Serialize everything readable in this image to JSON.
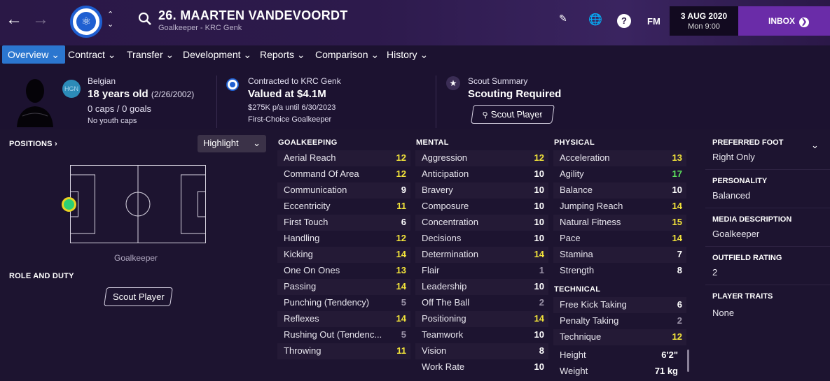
{
  "header": {
    "player_name": "26. MAARTEN VANDEVOORDT",
    "subtitle": "Goalkeeper - KRC Genk",
    "fm_label": "FM",
    "date": "3 AUG 2020",
    "time": "Mon 9:00",
    "inbox_label": "INBOX",
    "help_label": "?"
  },
  "tabs": [
    {
      "label": "Overview ⌄"
    },
    {
      "label": "Contract ⌄"
    },
    {
      "label": "Transfer ⌄"
    },
    {
      "label": "Development ⌄"
    },
    {
      "label": "Reports ⌄"
    },
    {
      "label": "Comparison ⌄"
    },
    {
      "label": "History ⌄"
    }
  ],
  "bio": {
    "nation_code": "HGN",
    "nationality": "Belgian",
    "age": "18 years old",
    "dob": "(2/26/2002)",
    "caps": "0 caps / 0 goals",
    "youth_caps": "No youth caps"
  },
  "contract": {
    "contracted_to": "Contracted to KRC Genk",
    "value": "Valued at $4.1M",
    "wage": "$275K p/a until 6/30/2023",
    "status": "First-Choice Goalkeeper"
  },
  "scout": {
    "title": "Scout Summary",
    "status": "Scouting Required",
    "button": "Scout Player"
  },
  "positions": {
    "label": "POSITIONS",
    "highlight": "Highlight",
    "position_name": "Goalkeeper",
    "role_label": "ROLE AND DUTY",
    "role_button": "Scout Player"
  },
  "goalkeeping": {
    "title": "GOALKEEPING",
    "attrs": [
      {
        "name": "Aerial Reach",
        "value": "12",
        "color": "#f2e33a"
      },
      {
        "name": "Command Of Area",
        "value": "12",
        "color": "#f2e33a"
      },
      {
        "name": "Communication",
        "value": "9",
        "color": "#ffffff"
      },
      {
        "name": "Eccentricity",
        "value": "11",
        "color": "#f2e33a"
      },
      {
        "name": "First Touch",
        "value": "6",
        "color": "#ffffff"
      },
      {
        "name": "Handling",
        "value": "12",
        "color": "#f2e33a"
      },
      {
        "name": "Kicking",
        "value": "14",
        "color": "#f2e33a"
      },
      {
        "name": "One On Ones",
        "value": "13",
        "color": "#f2e33a"
      },
      {
        "name": "Passing",
        "value": "14",
        "color": "#f2e33a"
      },
      {
        "name": "Punching (Tendency)",
        "value": "5",
        "color": "#9b93a8"
      },
      {
        "name": "Reflexes",
        "value": "14",
        "color": "#f2e33a"
      },
      {
        "name": "Rushing Out (Tendenc...",
        "value": "5",
        "color": "#9b93a8"
      },
      {
        "name": "Throwing",
        "value": "11",
        "color": "#f2e33a"
      }
    ]
  },
  "mental": {
    "title": "MENTAL",
    "attrs": [
      {
        "name": "Aggression",
        "value": "12",
        "color": "#f2e33a"
      },
      {
        "name": "Anticipation",
        "value": "10",
        "color": "#ffffff"
      },
      {
        "name": "Bravery",
        "value": "10",
        "color": "#ffffff"
      },
      {
        "name": "Composure",
        "value": "10",
        "color": "#ffffff"
      },
      {
        "name": "Concentration",
        "value": "10",
        "color": "#ffffff"
      },
      {
        "name": "Decisions",
        "value": "10",
        "color": "#ffffff"
      },
      {
        "name": "Determination",
        "value": "14",
        "color": "#f2e33a"
      },
      {
        "name": "Flair",
        "value": "1",
        "color": "#9b93a8"
      },
      {
        "name": "Leadership",
        "value": "10",
        "color": "#ffffff"
      },
      {
        "name": "Off The Ball",
        "value": "2",
        "color": "#9b93a8"
      },
      {
        "name": "Positioning",
        "value": "14",
        "color": "#f2e33a"
      },
      {
        "name": "Teamwork",
        "value": "10",
        "color": "#ffffff"
      },
      {
        "name": "Vision",
        "value": "8",
        "color": "#ffffff"
      },
      {
        "name": "Work Rate",
        "value": "10",
        "color": "#ffffff"
      }
    ]
  },
  "physical": {
    "title": "PHYSICAL",
    "attrs": [
      {
        "name": "Acceleration",
        "value": "13",
        "color": "#f2e33a"
      },
      {
        "name": "Agility",
        "value": "17",
        "color": "#5de35d"
      },
      {
        "name": "Balance",
        "value": "10",
        "color": "#ffffff"
      },
      {
        "name": "Jumping Reach",
        "value": "14",
        "color": "#f2e33a"
      },
      {
        "name": "Natural Fitness",
        "value": "15",
        "color": "#f2e33a"
      },
      {
        "name": "Pace",
        "value": "14",
        "color": "#f2e33a"
      },
      {
        "name": "Stamina",
        "value": "7",
        "color": "#ffffff"
      },
      {
        "name": "Strength",
        "value": "8",
        "color": "#ffffff"
      }
    ]
  },
  "technical": {
    "title": "TECHNICAL",
    "attrs": [
      {
        "name": "Free Kick Taking",
        "value": "6",
        "color": "#ffffff"
      },
      {
        "name": "Penalty Taking",
        "value": "2",
        "color": "#9b93a8"
      },
      {
        "name": "Technique",
        "value": "12",
        "color": "#f2e33a"
      }
    ]
  },
  "measures": [
    {
      "name": "Height",
      "value": "6'2\""
    },
    {
      "name": "Weight",
      "value": "71 kg"
    }
  ],
  "side": {
    "preferred_foot_label": "PREFERRED FOOT",
    "preferred_foot": "Right Only",
    "personality_label": "PERSONALITY",
    "personality": "Balanced",
    "media_label": "MEDIA DESCRIPTION",
    "media": "Goalkeeper",
    "outfield_label": "OUTFIELD RATING",
    "outfield": "2",
    "traits_label": "PLAYER TRAITS",
    "traits": "None"
  }
}
